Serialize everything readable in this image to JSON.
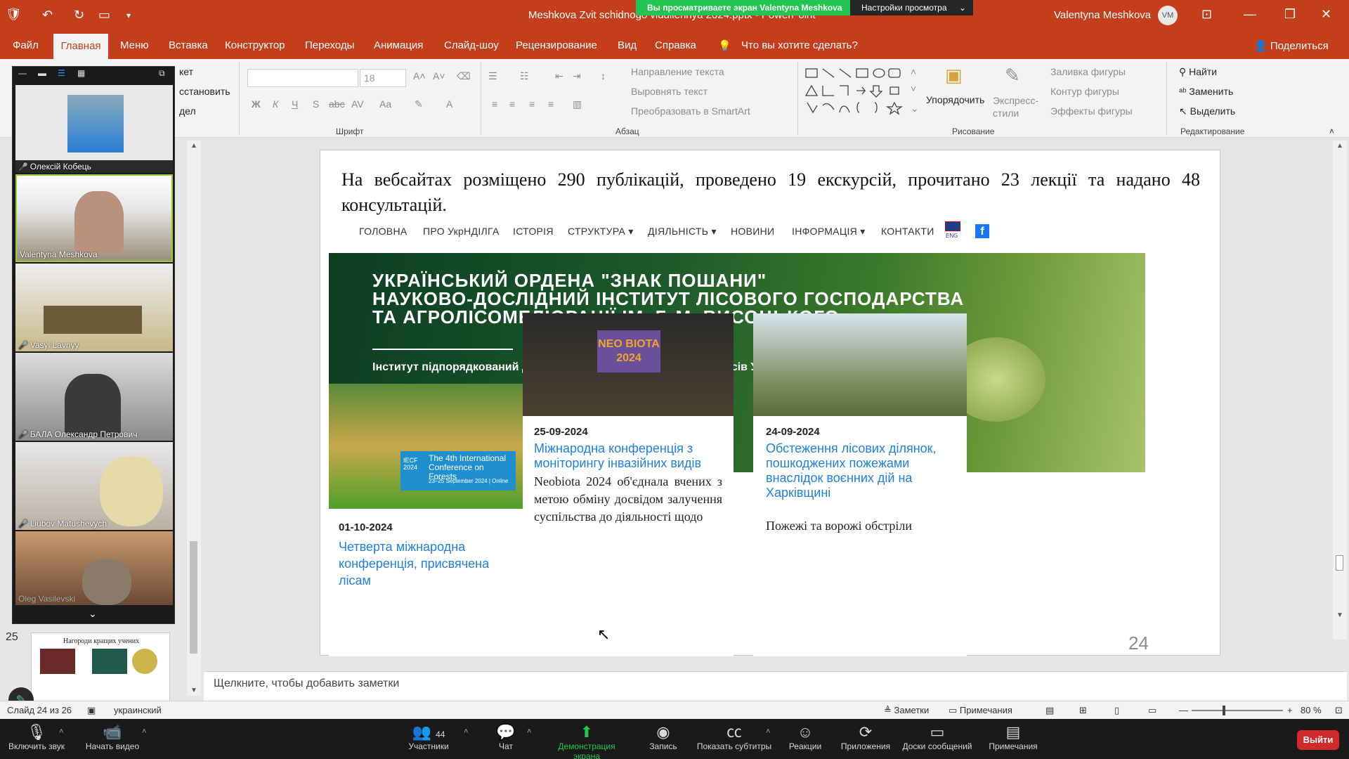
{
  "titlebar": {
    "doc_title": "Meshkova Zvit schidnogo viddilennya 2024.pptx - PowerPoint",
    "share_banner": "Вы просматриваете экран Valentyna Meshkova",
    "view_options": "Настройки просмотра",
    "user_name": "Valentynа Meshkova",
    "user_initials": "VM"
  },
  "menu": {
    "tabs": [
      "Файл",
      "Главная",
      "Меню",
      "Вставка",
      "Конструктор",
      "Переходы",
      "Анимация",
      "Слайд-шоу",
      "Рецензирование",
      "Вид",
      "Справка"
    ],
    "tell_me": "Что вы хотите сделать?",
    "share": "Поделиться"
  },
  "ribbon": {
    "font_size": "18",
    "groups": {
      "font": "Шрифт",
      "paragraph": "Абзац",
      "drawing": "Рисование",
      "editing": "Редактирование"
    },
    "text_direction": "Направление текста",
    "align_text": "Выровнять текст",
    "smartart": "Преобразовать в SmartArt",
    "arrange": "Упорядочить",
    "quick_styles": "Экспресс-стили",
    "shape_fill": "Заливка фигуры",
    "shape_outline": "Контур фигуры",
    "shape_effects": "Эффекты фигуры",
    "find": "Найти",
    "replace": "Заменить",
    "select": "Выделить",
    "layout_partial": "кет",
    "reset_partial": "сстановить",
    "section_partial": "дел"
  },
  "participants": [
    {
      "name": "Олексій Кобець"
    },
    {
      "name": "Valentyna Meshkova"
    },
    {
      "name": "Vasyl Lavnyy"
    },
    {
      "name": "БАЛА Олександр Петрович"
    },
    {
      "name": "Liubov Matushevych"
    },
    {
      "name": "Oleg Vasilevski"
    }
  ],
  "thumbnails": {
    "slide_25_number": "25",
    "slide_25_title": "Нагороди кращих учених"
  },
  "slide": {
    "text": "На вебсайтах розміщено 290 публікацій, проведено 19 екскурсій, прочитано 23 лекції та надано 48 консультацій.",
    "number": "24",
    "site_nav": [
      "ГОЛОВНА",
      "ПРО УкрНДІЛГА",
      "ІСТОРІЯ",
      "СТРУКТУРА",
      "ДІЯЛЬНІСТЬ",
      "НОВИНИ",
      "ІНФОРМАЦІЯ",
      "КОНТАКТИ"
    ],
    "lang": "ENG",
    "hero": {
      "line1": "УКРАЇНСЬКИЙ ОРДЕНА \"ЗНАК ПОШАНИ\"",
      "line2": "НАУКОВО-ДОСЛІДНИЙ ІНСТИТУТ ЛІСОВОГО ГОСПОДАРСТВА",
      "line3": "ТА АГРОЛІСОМЕЛІОРАЦІЇ ІМ. Г. М. ВИСОЦЬКОГО",
      "sub": "Інститут підпорядкований Державному агентству лісових ресурсів України"
    },
    "cards": [
      {
        "date": "01-10-2024",
        "title": "Четверта міжнародна конференція, присвячена лісам",
        "img_text": "The 4th International Conference on Forests",
        "img_sub": "23–25 September 2024 | Online",
        "img_badge": "IECF 2024"
      },
      {
        "date": "25-09-2024",
        "title": "Міжнародна конференція з моніторингу інвазійних видів",
        "body": "Neobiota 2024 об'єднала вчених з метою обміну досвідом залучення суспільства до діяльності щодо",
        "img_text": "NEO BIOTA 2024"
      },
      {
        "date": "24-09-2024",
        "title": "Обстеження лісових ділянок, пошкоджених пожежами внаслідок воєнних дій на Харківщині",
        "body": "Пожежі та ворожі обстріли"
      }
    ]
  },
  "notes_placeholder": "Щелкните, чтобы добавить заметки",
  "statusbar": {
    "slide_info": "Слайд 24 из 26",
    "language": "украинский",
    "notes": "Заметки",
    "comments": "Примечания",
    "zoom": "80 %"
  },
  "zoom": {
    "mute": "Включить звук",
    "video": "Начать видео",
    "participants": "Участники",
    "participants_count": "44",
    "chat": "Чат",
    "share": "Демонстрация экрана",
    "record": "Запись",
    "captions": "Показать субтитры",
    "reactions": "Реакции",
    "apps": "Приложения",
    "whiteboards": "Доски сообщений",
    "notes": "Примечания",
    "leave": "Выйти"
  }
}
